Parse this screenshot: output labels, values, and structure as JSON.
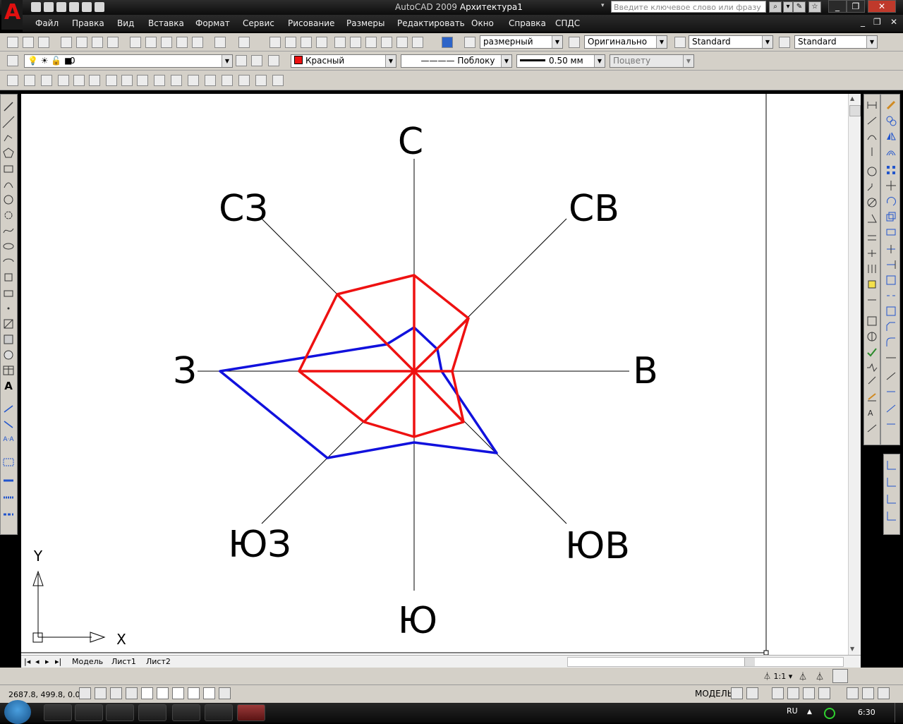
{
  "app": {
    "title_app": "AutoCAD 2009",
    "title_doc": "Архитектура1",
    "search_placeholder": "Введите ключевое слово или фразу",
    "logo_letter": "A"
  },
  "menu": [
    "Файл",
    "Правка",
    "Вид",
    "Вставка",
    "Формат",
    "Сервис",
    "Рисование",
    "Размеры",
    "Редактировать",
    "Окно",
    "Справка",
    "СПДС"
  ],
  "toolbar": {
    "dimstyle": "размерный",
    "textstyle": "Оригинально",
    "tablestyle": "Standard",
    "mleaderstyle": "Standard",
    "layer": "0",
    "color": "Красный",
    "linetype": "Поблоку",
    "lineweight": "0.50 мм",
    "plotstyle": "Поцвету"
  },
  "drawing": {
    "labels": {
      "n": "С",
      "ne": "СВ",
      "e": "В",
      "se": "ЮВ",
      "s": "Ю",
      "sw": "ЮЗ",
      "w": "З",
      "nw": "СЗ"
    },
    "ucs": {
      "x": "X",
      "y": "Y"
    },
    "colors": {
      "red": "#ee1111",
      "blue": "#1111dd",
      "axis": "#000000"
    }
  },
  "layout_tabs": [
    "Модель",
    "Лист1",
    "Лист2"
  ],
  "status": {
    "coords": "2687.8, 499.8, 0.0",
    "scale": "1:1",
    "space": "МОДЕЛЬ"
  },
  "taskbar": {
    "lang": "RU",
    "time": "6:30"
  }
}
